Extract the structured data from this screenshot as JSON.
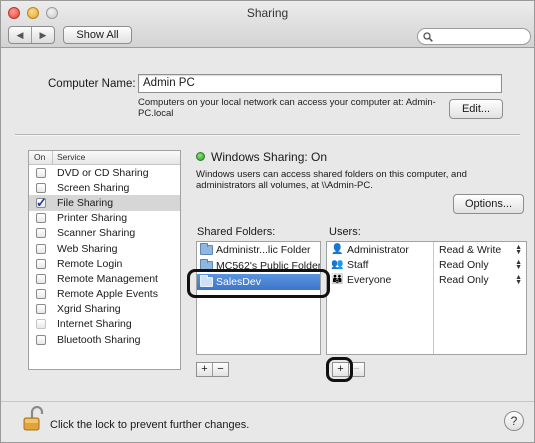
{
  "window": {
    "title": "Sharing"
  },
  "toolbar": {
    "back_glyph": "◀",
    "forward_glyph": "▶",
    "show_all_label": "Show All",
    "search_placeholder": ""
  },
  "computer_name": {
    "label": "Computer Name:",
    "value": "Admin PC",
    "note": "Computers on your local network can access your computer at: Admin-PC.local",
    "edit_label": "Edit..."
  },
  "services": {
    "header_on": "On",
    "header_service": "Service",
    "items": [
      {
        "label": "DVD or CD Sharing",
        "checked": false,
        "selected": false,
        "dim": false
      },
      {
        "label": "Screen Sharing",
        "checked": false,
        "selected": false,
        "dim": false
      },
      {
        "label": "File Sharing",
        "checked": true,
        "selected": true,
        "dim": false
      },
      {
        "label": "Printer Sharing",
        "checked": false,
        "selected": false,
        "dim": false
      },
      {
        "label": "Scanner Sharing",
        "checked": false,
        "selected": false,
        "dim": false
      },
      {
        "label": "Web Sharing",
        "checked": false,
        "selected": false,
        "dim": false
      },
      {
        "label": "Remote Login",
        "checked": false,
        "selected": false,
        "dim": false
      },
      {
        "label": "Remote Management",
        "checked": false,
        "selected": false,
        "dim": false
      },
      {
        "label": "Remote Apple Events",
        "checked": false,
        "selected": false,
        "dim": false
      },
      {
        "label": "Xgrid Sharing",
        "checked": false,
        "selected": false,
        "dim": false
      },
      {
        "label": "Internet Sharing",
        "checked": false,
        "selected": false,
        "dim": true
      },
      {
        "label": "Bluetooth Sharing",
        "checked": false,
        "selected": false,
        "dim": false
      }
    ]
  },
  "detail": {
    "status_title": "Windows Sharing: On",
    "status_desc": "Windows users can access shared folders on this computer, and administrators all volumes, at \\\\Admin-PC.",
    "options_label": "Options...",
    "shared_folders_label": "Shared Folders:",
    "users_label": "Users:",
    "folders": [
      {
        "name": "Administr...lic Folder",
        "selected": false
      },
      {
        "name": "MC562's Public Folder",
        "selected": false
      },
      {
        "name": "SalesDev",
        "selected": true
      }
    ],
    "users": [
      {
        "icon": "single-user-icon",
        "name": "Administrator",
        "permission": "Read & Write"
      },
      {
        "icon": "group-icon",
        "name": "Staff",
        "permission": "Read Only"
      },
      {
        "icon": "everyone-icon",
        "name": "Everyone",
        "permission": "Read Only"
      }
    ],
    "add_glyph": "+",
    "remove_glyph": "−"
  },
  "footer": {
    "lock_text": "Click the lock to prevent further changes.",
    "help_glyph": "?"
  },
  "colors": {
    "selection_blue": "#3c76c8",
    "status_green": "#2e9a22",
    "close_red": "#e0443a",
    "minimize_yellow": "#e0a72d"
  }
}
